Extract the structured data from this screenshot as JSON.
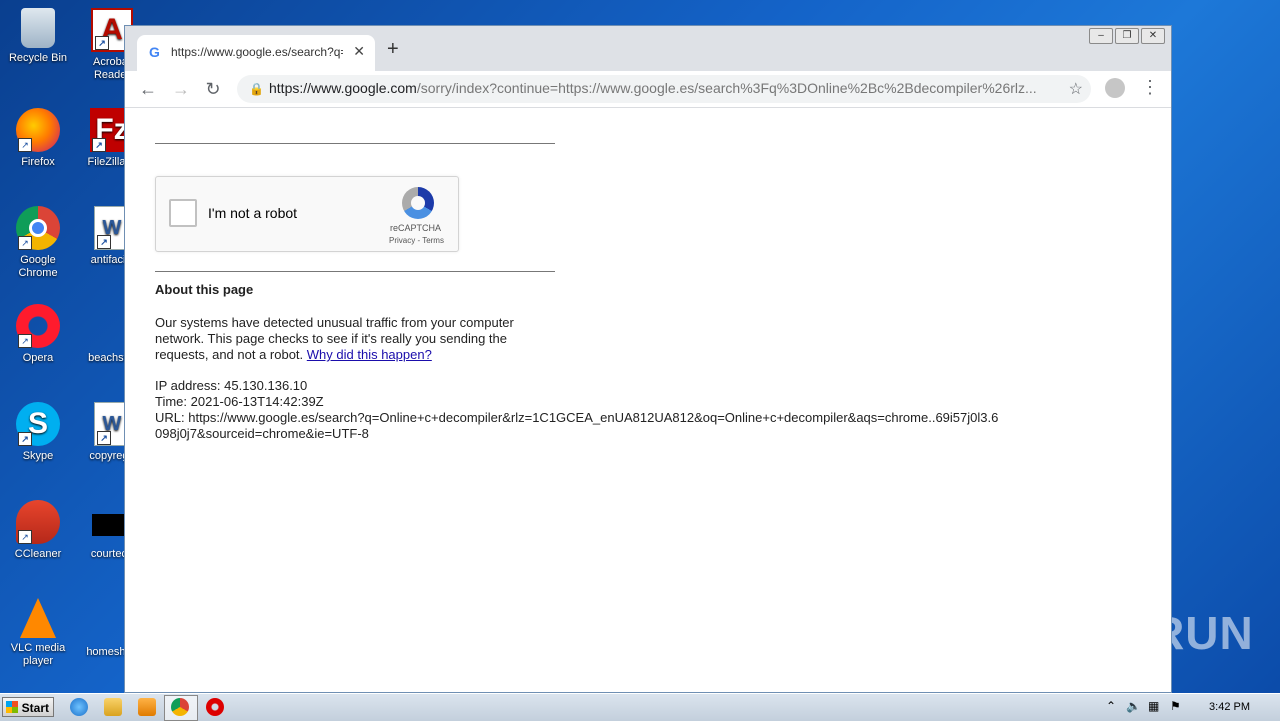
{
  "desktop": {
    "icons": [
      {
        "label": "Recycle Bin"
      },
      {
        "label": "Acrobat Reader"
      },
      {
        "label": "Firefox"
      },
      {
        "label": "FileZilla C"
      },
      {
        "label": "Google Chrome"
      },
      {
        "label": "antifacilit"
      },
      {
        "label": "Opera"
      },
      {
        "label": "beachstat"
      },
      {
        "label": "Skype"
      },
      {
        "label": "copyrega"
      },
      {
        "label": "CCleaner"
      },
      {
        "label": "courteco"
      },
      {
        "label": "VLC media player"
      },
      {
        "label": "homeshtm"
      }
    ]
  },
  "browser": {
    "tab_title": "https://www.google.es/search?q=Online+c+decompiler",
    "tab_favicon": "G",
    "url_host": "https://www.google.com",
    "url_rest": "/sorry/index?continue=https://www.google.es/search%3Fq%3DOnline%2Bc%2Bdecompiler%26rlz..."
  },
  "page": {
    "captcha_label": "I'm not a robot",
    "captcha_brand": "reCAPTCHA",
    "captcha_links": "Privacy - Terms",
    "about_heading": "About this page",
    "about_text": "Our systems have detected unusual traffic from your computer network. This page checks to see if it's really you sending the requests, and not a robot.",
    "why_link": "Why did this happen?",
    "ip": "IP address: 45.130.136.10",
    "time": "Time: 2021-06-13T14:42:39Z",
    "url": "URL: https://www.google.es/search?q=Online+c+decompiler&rlz=1C1GCEA_enUA812UA812&oq=Online+c+decompiler&aqs=chrome..69i57j0l3.6098j0j7&sourceid=chrome&ie=UTF-8"
  },
  "taskbar": {
    "start_label": "Start",
    "clock": "3:42 PM"
  },
  "watermark": "ANY RUN"
}
